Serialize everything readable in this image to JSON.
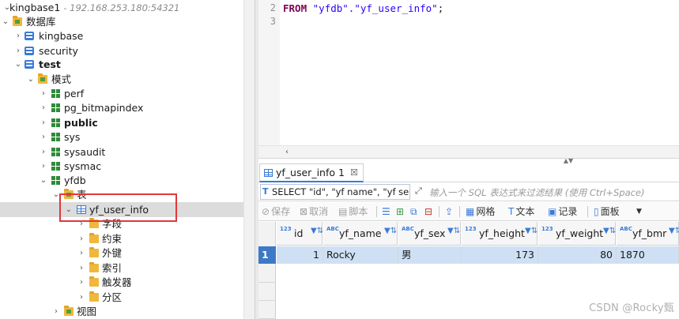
{
  "navigator": {
    "connection": {
      "name": "kingbase1",
      "address": "- 192.168.253.180:54321"
    },
    "databases_folder": "数据库",
    "databases": [
      "kingbase",
      "security",
      "test"
    ],
    "schemas_folder": "模式",
    "schemas": [
      "perf",
      "pg_bitmapindex",
      "public",
      "sys",
      "sysaudit",
      "sysmac",
      "yfdb"
    ],
    "tables_folder": "表",
    "selected_table": "yf_user_info",
    "table_children": [
      "字段",
      "约束",
      "外键",
      "索引",
      "触发器",
      "分区"
    ],
    "views_folder": "视图"
  },
  "editor": {
    "lines": [
      {
        "number": "2",
        "keyword": "FROM",
        "text": "\"yfdb\".\"yf_user_info\"",
        "end": ";"
      },
      {
        "number": "3",
        "keyword": "",
        "text": "",
        "end": ""
      }
    ]
  },
  "results": {
    "tab_label": "yf_user_info 1",
    "tab_close": "☒",
    "filter_sql": "SELECT \"id\", \"yf name\", \"yf se",
    "filter_hint": "输入一个 SQL 表达式来过滤结果 (使用 Ctrl+Space)",
    "toolbar": {
      "save": "保存",
      "cancel": "取消",
      "script": "脚本",
      "grid": "网格",
      "text": "文本",
      "record": "记录",
      "panel": "面板"
    },
    "columns": [
      {
        "type": "123",
        "name": "id"
      },
      {
        "type": "ABC",
        "name": "yf_name"
      },
      {
        "type": "ABC",
        "name": "yf_sex"
      },
      {
        "type": "123",
        "name": "yf_height"
      },
      {
        "type": "123",
        "name": "yf_weight"
      },
      {
        "type": "ABC",
        "name": "yf_bmr"
      }
    ],
    "rows": [
      {
        "num": "1",
        "cells": [
          "1",
          "Rocky",
          "男",
          "173",
          "80",
          "1870"
        ]
      }
    ]
  },
  "watermark": "CSDN @Rocky甄"
}
